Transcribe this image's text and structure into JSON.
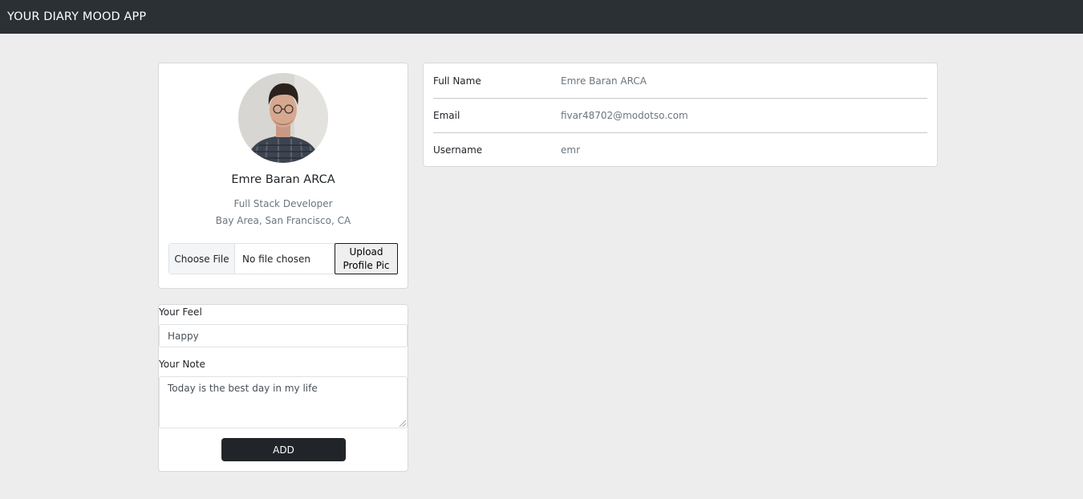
{
  "app": {
    "brand": "YOUR DIARY MOOD APP"
  },
  "profile": {
    "name": "Emre Baran ARCA",
    "title": "Full Stack Developer",
    "location": "Bay Area, San Francisco, CA",
    "file_input": {
      "button_label": "Choose File",
      "status": "No file chosen"
    },
    "upload_button": "Upload Profile Pic"
  },
  "mood_form": {
    "feel_label": "Your Feel",
    "feel_value": "Happy",
    "note_label": "Your Note",
    "note_value": "Today is the best day in my life",
    "add_button": "ADD"
  },
  "details": {
    "rows": [
      {
        "label": "Full Name",
        "value": "Emre Baran ARCA"
      },
      {
        "label": "Email",
        "value": "fivar48702@modotso.com"
      },
      {
        "label": "Username",
        "value": "emr"
      }
    ]
  },
  "colors": {
    "navbar": "#2b3035",
    "background": "#ededed",
    "primary_button": "#212529"
  }
}
